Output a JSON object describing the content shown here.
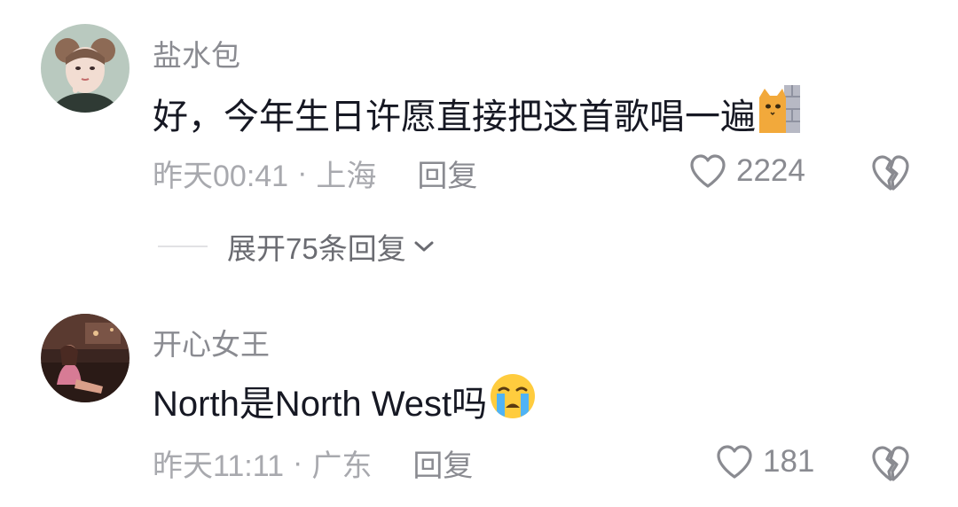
{
  "comments": [
    {
      "username": "盐水包",
      "text": "好，今年生日许愿直接把这首歌唱一遍",
      "emoji": "cat-peeking-wall-emoji",
      "time": "昨天00:41",
      "location": "上海",
      "separator": "·",
      "reply_label": "回复",
      "likes": "2224",
      "expand_replies": "展开75条回复"
    },
    {
      "username": "开心女王",
      "text": "North是North West吗",
      "emoji": "crying-face-emoji",
      "time": "昨天11:11",
      "location": "广东",
      "separator": "·",
      "reply_label": "回复",
      "likes": "181"
    }
  ],
  "colors": {
    "username": "#8a8b91",
    "text": "#161823",
    "meta": "#a8a9ae",
    "icon": "#8a8b91"
  }
}
